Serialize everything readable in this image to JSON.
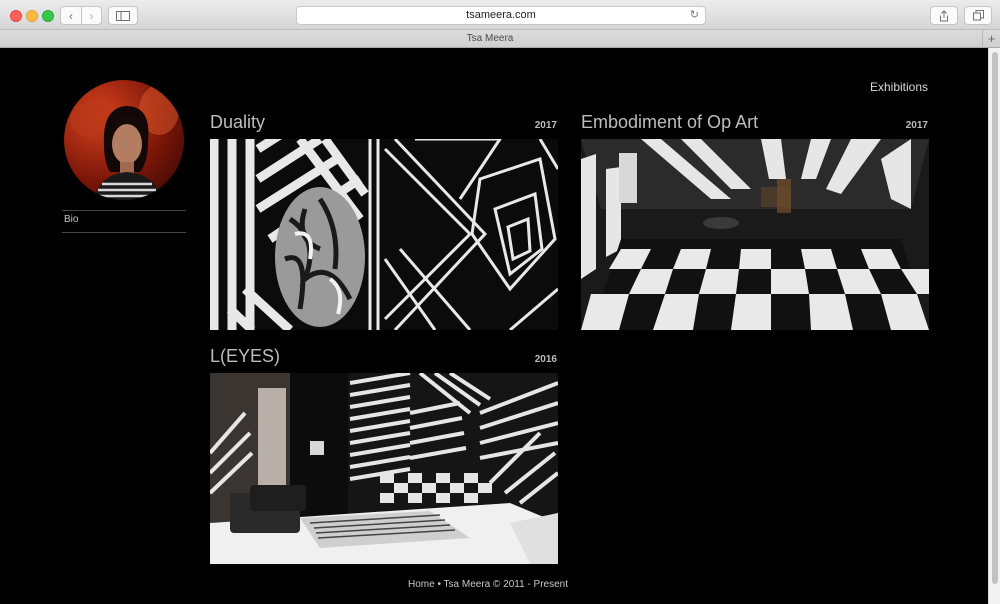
{
  "browser": {
    "url": "tsameera.com",
    "tab_title": "Tsa Meera"
  },
  "sidebar": {
    "bio_label": "Bio"
  },
  "nav": {
    "exhibitions_label": "Exhibitions"
  },
  "cards": [
    {
      "title": "Duality",
      "year": "2017"
    },
    {
      "title": "Embodiment of Op Art",
      "year": "2017"
    },
    {
      "title": "L(EYES)",
      "year": "2016"
    }
  ],
  "footer": {
    "text": "Home • Tsa Meera © 2011 - Present"
  },
  "colors": {
    "page_background": "#000000",
    "title_text": "#bdbdbd"
  }
}
